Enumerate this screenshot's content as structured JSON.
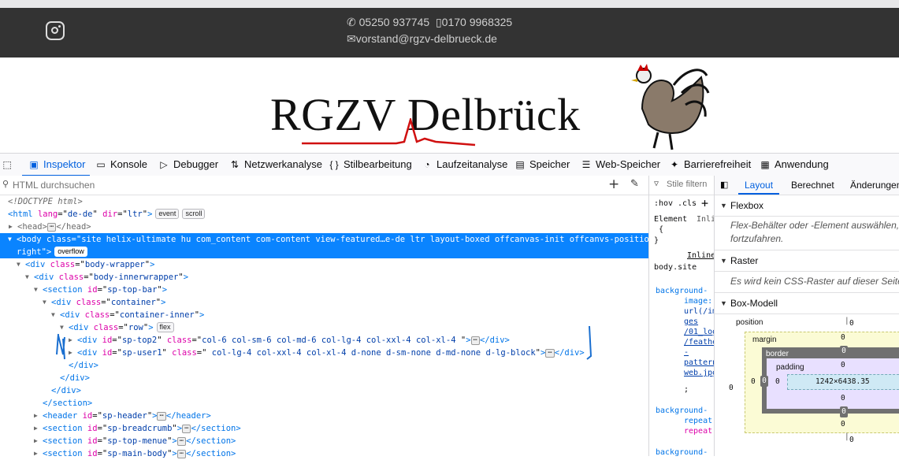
{
  "site": {
    "phone1": "05250 937745",
    "phone2": "0170 9968325",
    "email": "vorstand@rgzv-delbrueck.de",
    "logo_text": "RGZV Delbrück"
  },
  "devtools": {
    "tabs": [
      {
        "label": "Inspektor",
        "icon": "inspector-icon"
      },
      {
        "label": "Konsole",
        "icon": "console-icon"
      },
      {
        "label": "Debugger",
        "icon": "debugger-icon"
      },
      {
        "label": "Netzwerkanalyse",
        "icon": "network-icon"
      },
      {
        "label": "Stilbearbeitung",
        "icon": "style-editor-icon"
      },
      {
        "label": "Laufzeitanalyse",
        "icon": "performance-icon"
      },
      {
        "label": "Speicher",
        "icon": "memory-icon"
      },
      {
        "label": "Web-Speicher",
        "icon": "storage-icon"
      },
      {
        "label": "Barrierefreiheit",
        "icon": "accessibility-icon"
      },
      {
        "label": "Anwendung",
        "icon": "application-icon"
      }
    ],
    "active_tab": "Inspektor",
    "search_placeholder": "HTML durchsuchen",
    "markup": {
      "doctype": "<!DOCTYPE html>",
      "html_lang": "de-de",
      "html_dir": "ltr",
      "badge_event": "event",
      "badge_scroll": "scroll",
      "badge_overflow": "overflow",
      "badge_flex": "flex",
      "body_class": "site helix-ultimate hu com_content com-content view-featured…e-de ltr layout-boxed offcanvas-init offcanvs-position-",
      "body_class_cont": "right",
      "div_body_wrapper": "body-wrapper",
      "div_body_innerwrapper": "body-innerwrapper",
      "section_top_bar": "sp-top-bar",
      "div_container": "container",
      "div_container_inner": "container-inner",
      "div_row": "row",
      "top2_id": "sp-top2",
      "top2_class": "col-6 col-sm-6 col-md-6 col-lg-4 col-xxl-4 col-xl-4 ",
      "user1_id": "sp-user1",
      "user1_class": " col-lg-4 col-xxl-4 col-xl-4 d-none d-sm-none d-md-none d-lg-block",
      "header_id": "sp-header",
      "breadcrumb_id": "sp-breadcrumb",
      "top_menue_id": "sp-top-menue",
      "main_body_id": "sp-main-body"
    },
    "rules": {
      "filter_placeholder": "Stile filtern",
      "hov": ":hov",
      "cls": ".cls",
      "element": "Element",
      "inline": "Inli",
      "open_brace": "{",
      "close_brace": "}",
      "inline_link": "Inline",
      "selector": "body.site",
      "bg_image_prop1": "background-",
      "bg_image_prop2": "image:",
      "url_parts": [
        "url(/im",
        "ges",
        "/01_log",
        "/feathe",
        "-",
        "pattern",
        "web.jpg"
      ],
      "semicolon": ";",
      "bg_repeat1": "background-",
      "bg_repeat2": "repeat:",
      "bg_repeat3": "repeat;",
      "bg_more": "background-"
    },
    "layout": {
      "tabs": [
        "Layout",
        "Berechnet",
        "Änderungen"
      ],
      "flexbox_title": "Flexbox",
      "flexbox_note1": "Flex-Behälter oder -Element auswählen, u",
      "flexbox_note2": "fortzufahren.",
      "grid_title": "Raster",
      "grid_note": "Es wird kein CSS-Raster auf dieser Seite v",
      "boxmodel_title": "Box-Modell",
      "position_label": "position",
      "margin_label": "margin",
      "border_label": "border",
      "padding_label": "padding",
      "content_size": "1242×6438.35",
      "zero": "0"
    }
  }
}
